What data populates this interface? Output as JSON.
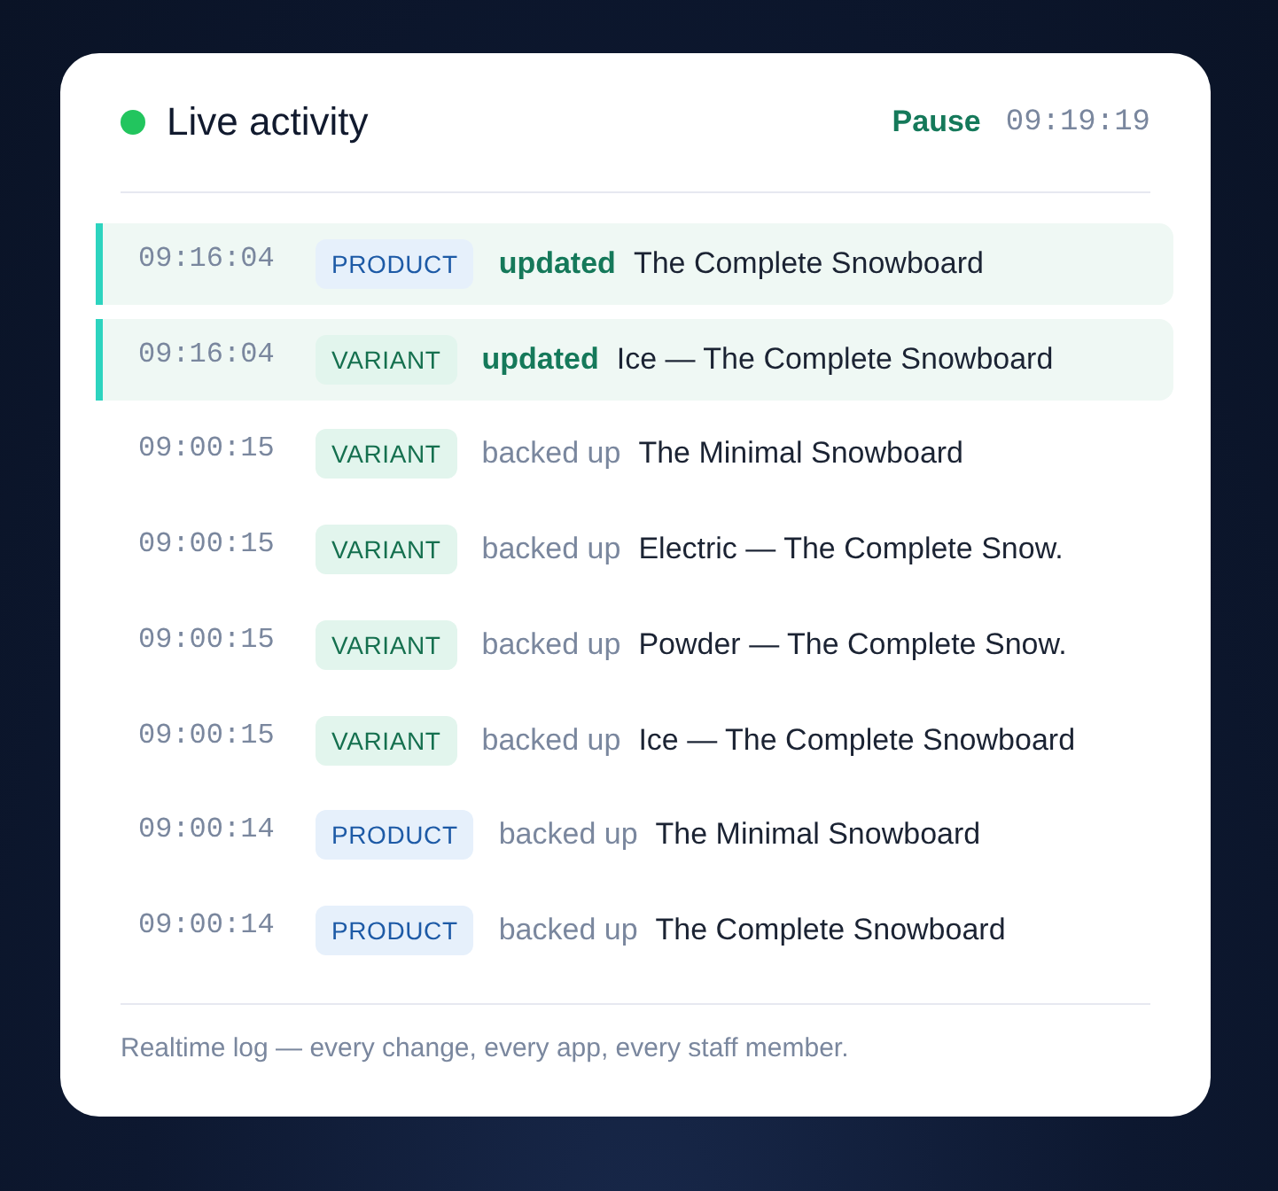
{
  "header": {
    "title": "Live activity",
    "live": true,
    "pause_label": "Pause",
    "clock": "09:19:19"
  },
  "events": [
    {
      "time": "09:16:04",
      "kind": "product",
      "tag": "PRODUCT",
      "action": "updated",
      "target": "The Complete Snowboard",
      "highlighted": true
    },
    {
      "time": "09:16:04",
      "kind": "variant",
      "tag": "VARIANT",
      "action": "updated",
      "target": "Ice — The Complete Snowboard",
      "highlighted": true
    },
    {
      "time": "09:00:15",
      "kind": "variant",
      "tag": "VARIANT",
      "action": "backed up",
      "target": "The Minimal Snowboard",
      "highlighted": false
    },
    {
      "time": "09:00:15",
      "kind": "variant",
      "tag": "VARIANT",
      "action": "backed up",
      "target": "Electric — The Complete Snow.",
      "highlighted": false
    },
    {
      "time": "09:00:15",
      "kind": "variant",
      "tag": "VARIANT",
      "action": "backed up",
      "target": "Powder — The Complete Snow.",
      "highlighted": false
    },
    {
      "time": "09:00:15",
      "kind": "variant",
      "tag": "VARIANT",
      "action": "backed up",
      "target": "Ice — The Complete Snowboard",
      "highlighted": false
    },
    {
      "time": "09:00:14",
      "kind": "product",
      "tag": "PRODUCT",
      "action": "backed up",
      "target": "The Minimal Snowboard",
      "highlighted": false
    },
    {
      "time": "09:00:14",
      "kind": "product",
      "tag": "PRODUCT",
      "action": "backed up",
      "target": "The Complete Snowboard",
      "highlighted": false
    }
  ],
  "footer": "Realtime log — every change, every app, every staff member."
}
